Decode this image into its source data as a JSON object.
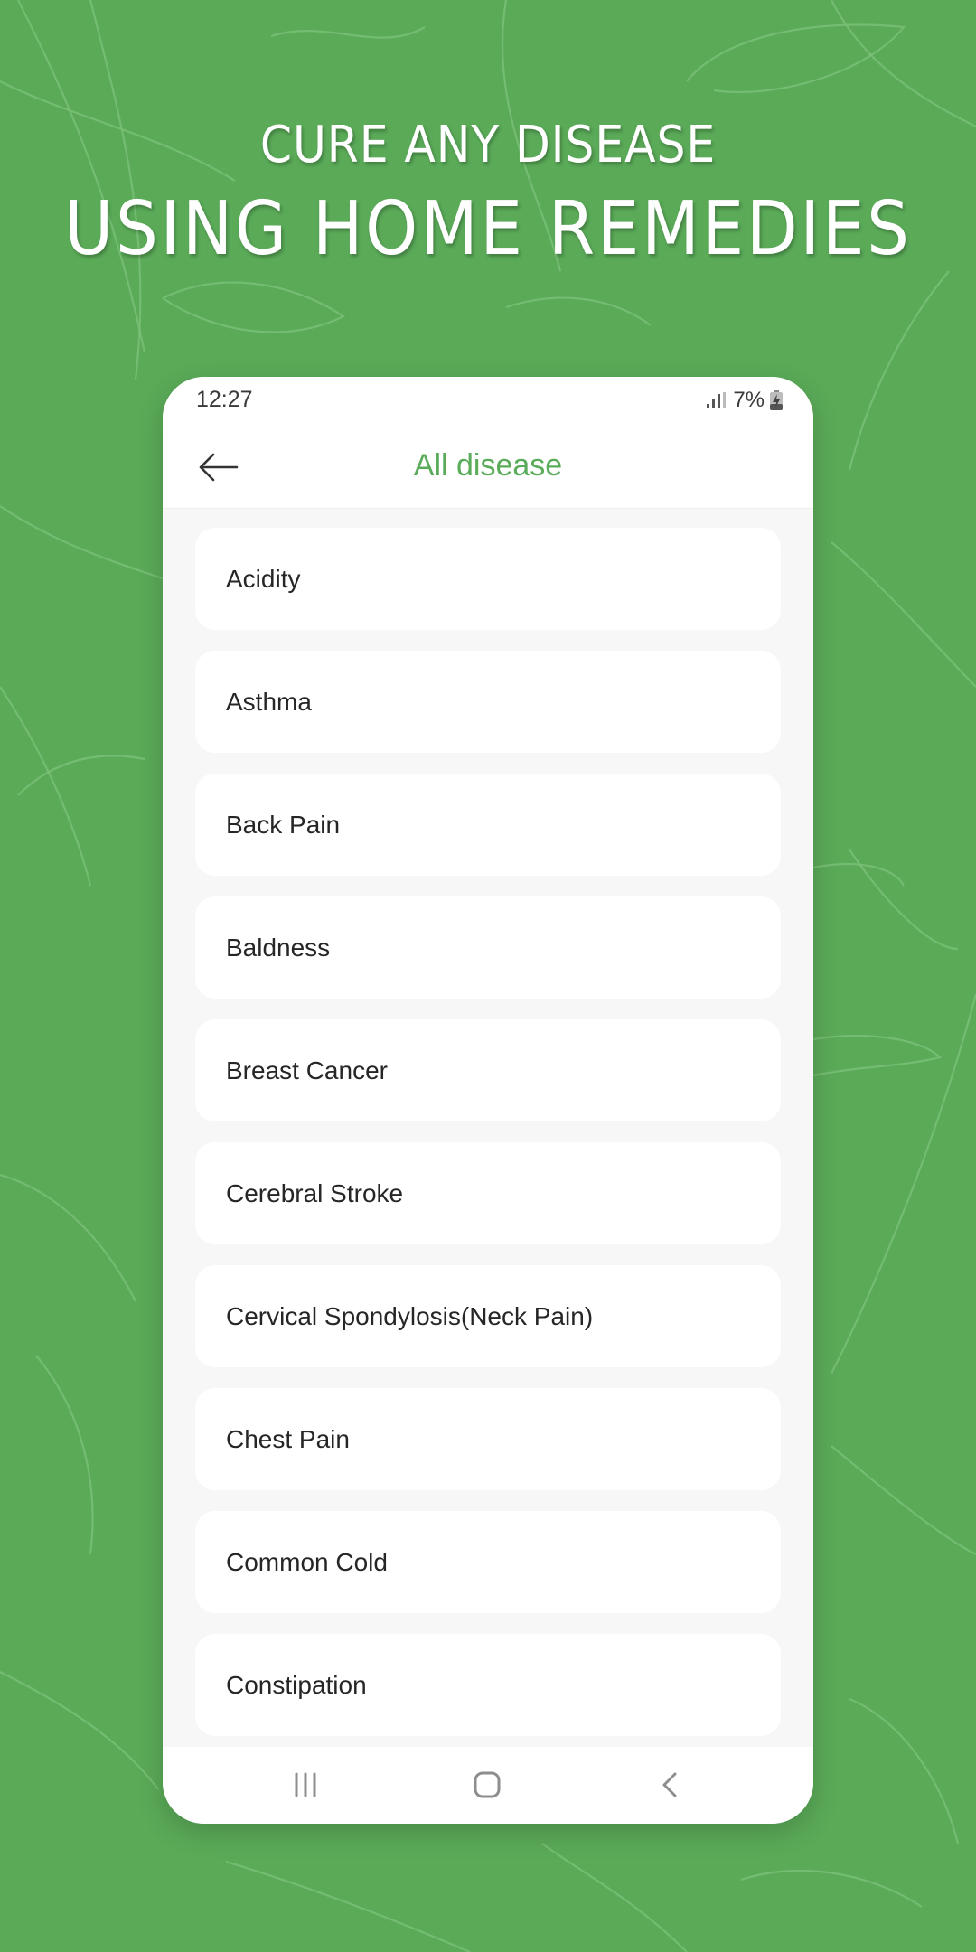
{
  "promo": {
    "headline_line1": "CURE ANY DISEASE",
    "headline_line2": "USING HOME REMEDIES",
    "background_color": "#5aaa58"
  },
  "status_bar": {
    "time": "12:27",
    "battery": "7%",
    "signal_icon": "signal-icon",
    "battery_icon": "battery-charging-icon"
  },
  "app_bar": {
    "title": "All disease",
    "back_icon": "arrow-left-icon",
    "accent_color": "#5aac5a"
  },
  "diseases": [
    {
      "label": "Acidity"
    },
    {
      "label": "Asthma"
    },
    {
      "label": "Back Pain"
    },
    {
      "label": "Baldness"
    },
    {
      "label": "Breast Cancer"
    },
    {
      "label": "Cerebral Stroke"
    },
    {
      "label": "Cervical Spondylosis(Neck Pain)"
    },
    {
      "label": "Chest Pain"
    },
    {
      "label": "Common Cold"
    },
    {
      "label": "Constipation"
    }
  ],
  "nav_bar": {
    "recents_icon": "recents-icon",
    "home_icon": "home-icon",
    "back_icon": "chevron-left-icon"
  }
}
